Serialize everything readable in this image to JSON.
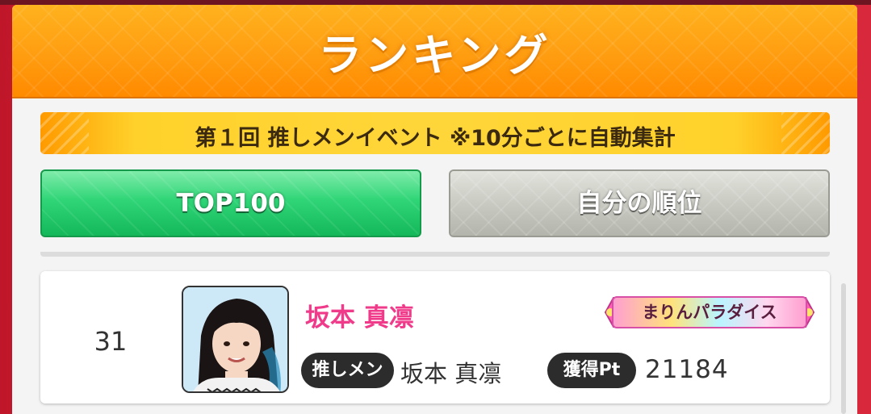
{
  "header": {
    "title": "ランキング"
  },
  "event": {
    "banner_text": "第１回 推しメンイベント ※10分ごとに自動集計"
  },
  "tabs": [
    {
      "label": "TOP100",
      "active": true
    },
    {
      "label": "自分の順位",
      "active": false
    }
  ],
  "ranking_rows": [
    {
      "rank": "31",
      "name": "坂本 真凛",
      "badge": "まりんパラダイス",
      "oshimen_label": "推しメン",
      "oshimen_value": "坂本 真凛",
      "pt_label": "獲得Pt",
      "pt_value": "21184"
    }
  ],
  "colors": {
    "header": "#ff9d10",
    "banner": "#ffd63a",
    "active_tab": "#2fd577",
    "inactive_tab": "#c9cac2",
    "name_pink": "#ef3b8a"
  }
}
